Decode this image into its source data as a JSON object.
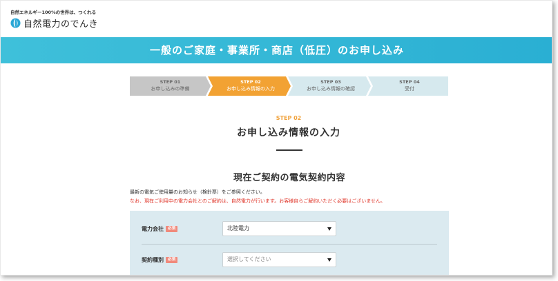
{
  "header": {
    "tagline": "自然エネルギー100%の世界は、つくれる",
    "logo_text": "自然電力のでんき"
  },
  "banner": {
    "title": "一般のご家庭・事業所・商店（低圧）のお申し込み"
  },
  "steps": [
    {
      "num": "STEP 01",
      "label": "お申し込みの準備",
      "state": "done"
    },
    {
      "num": "STEP 02",
      "label": "お申し込み情報の入力",
      "state": "active"
    },
    {
      "num": "STEP 03",
      "label": "お申し込み情報の確認",
      "state": "upcoming"
    },
    {
      "num": "STEP 04",
      "label": "受付",
      "state": "upcoming"
    }
  ],
  "section": {
    "step": "STEP 02",
    "title": "お申し込み情報の入力"
  },
  "subsection": {
    "title": "現在ご契約の電気契約内容",
    "note": "最新の電気ご使用量のお知らせ（検針票）をご参照ください。",
    "warning": "なお、現在ご利用中の電力会社とのご解約は、自然電力が行います。お客様自らご解約いただく必要はございません。"
  },
  "form": {
    "required_label": "必須",
    "company": {
      "label": "電力会社",
      "value": "北陸電力"
    },
    "contract_type": {
      "label": "契約種別",
      "placeholder": "選択してください"
    }
  },
  "colors": {
    "banner": "#2aafd3",
    "step_active": "#f2a233",
    "step_done": "#c6c6c6",
    "step_upcoming": "#d6e9ee",
    "warning": "#e0382c",
    "form_bg": "#dbeaf0",
    "required_badge": "#f08a7c"
  }
}
